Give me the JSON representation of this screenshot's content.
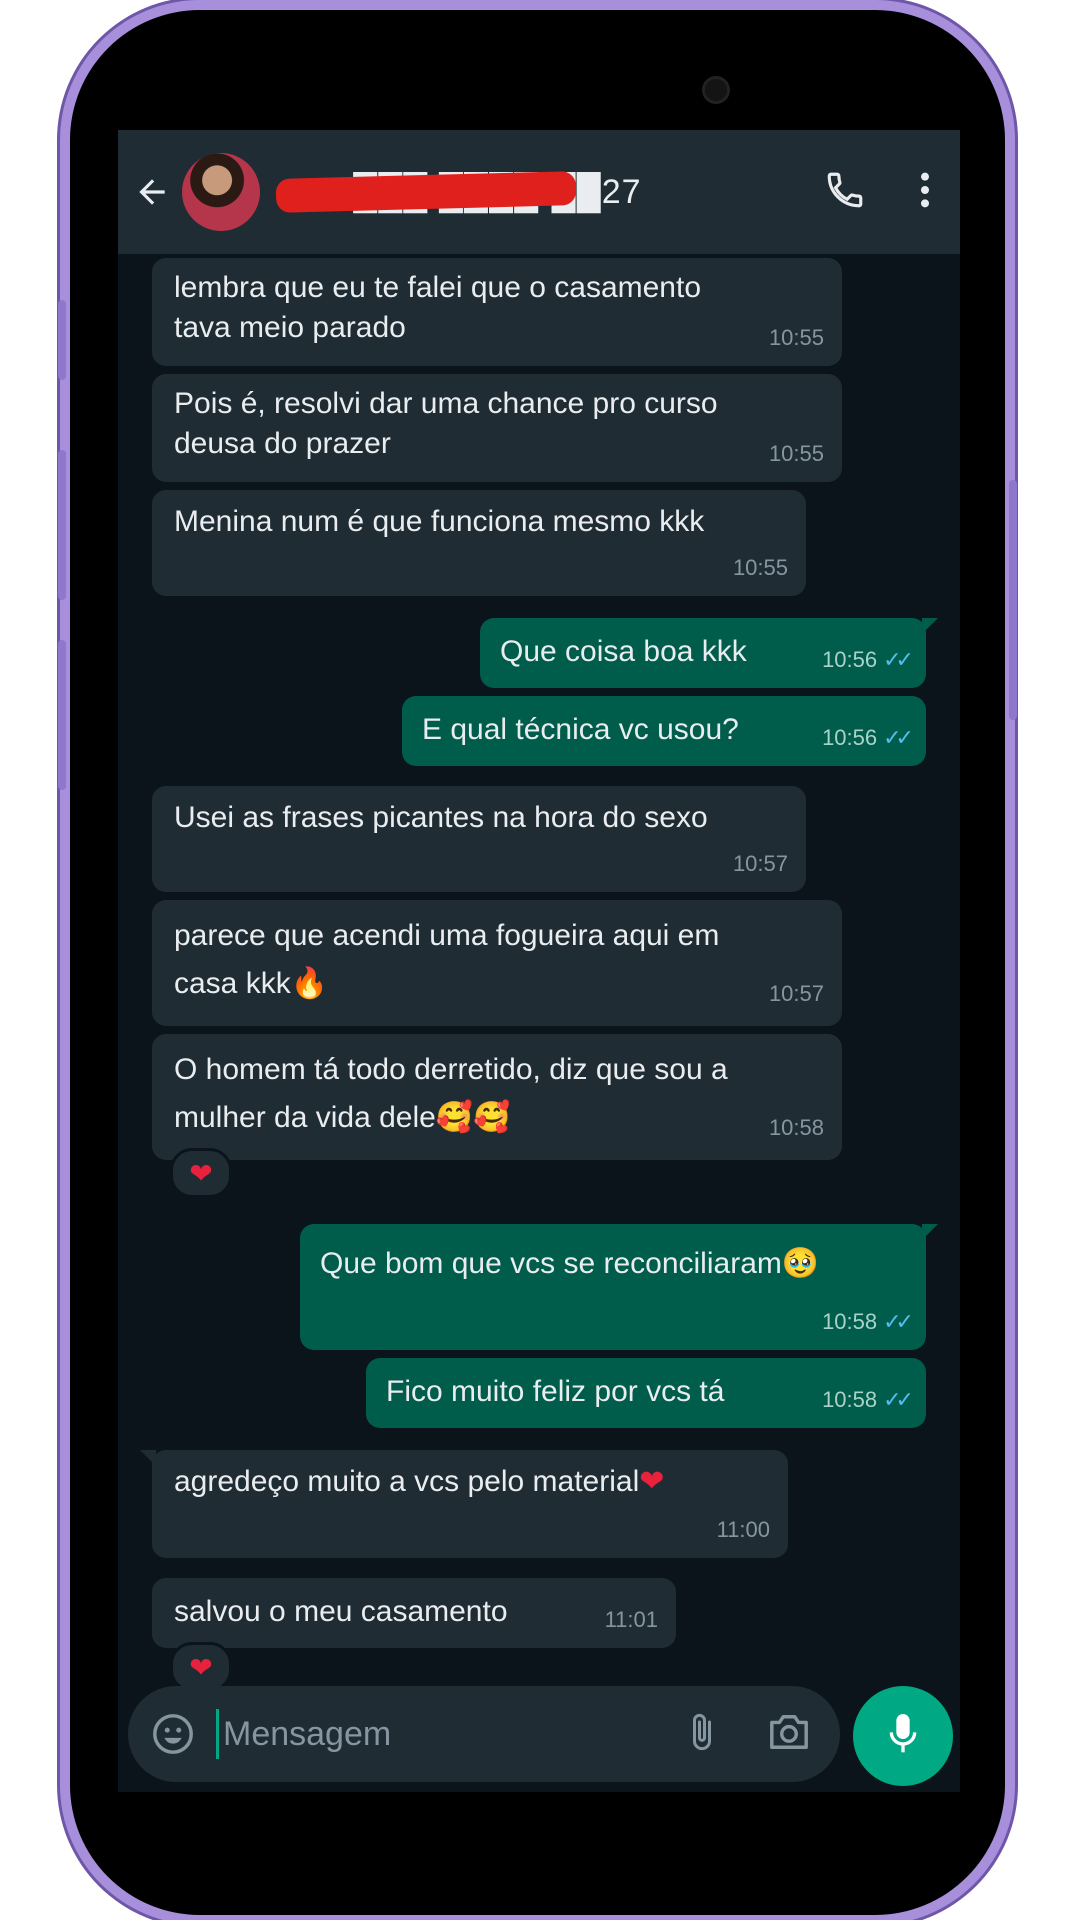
{
  "header": {
    "contact_number": "+55 ███ ████-██27"
  },
  "input": {
    "placeholder": "Mensagem"
  },
  "messages": [
    {
      "text_line1": "lembra que eu te falei que o casamento",
      "text_line2": "tava meio parado",
      "time": "10:55"
    },
    {
      "text_line1": "Pois é, resolvi dar uma chance pro curso",
      "text_line2": "deusa do prazer",
      "time": "10:55"
    },
    {
      "text": "Menina num é que funciona mesmo kkk",
      "time": "10:55"
    },
    {
      "text": "Que coisa boa kkk",
      "time": "10:56"
    },
    {
      "text": "E qual técnica vc usou?",
      "time": "10:56"
    },
    {
      "text": "Usei as frases picantes na hora do sexo",
      "time": "10:57"
    },
    {
      "text_line1": "parece que acendi uma fogueira aqui em",
      "text_line2": "casa kkk",
      "emoji": "🔥",
      "time": "10:57"
    },
    {
      "text_line1": "O homem tá todo derretido, diz que sou a",
      "text_line2": "mulher da vida dele",
      "emoji": "🥰🥰",
      "time": "10:58",
      "reaction": "❤"
    },
    {
      "text": "Que bom que vcs se reconciliaram",
      "emoji": "🥹",
      "time": "10:58"
    },
    {
      "text": "Fico muito feliz por vcs tá",
      "time": "10:58"
    },
    {
      "text": "agredeço muito a vcs pelo material",
      "emoji": "❤",
      "time": "11:00"
    },
    {
      "text": "salvou o meu casamento",
      "time": "11:01",
      "reaction": "❤"
    }
  ],
  "colors": {
    "header_bg": "#1f2c34",
    "chat_bg": "#0b141a",
    "incoming_bubble": "#202c33",
    "outgoing_bubble": "#005c4b",
    "accent": "#00a884",
    "read_ticks": "#53bdeb"
  },
  "icons": [
    "back-arrow-icon",
    "phone-icon",
    "more-vert-icon",
    "emoji-icon",
    "attach-icon",
    "camera-icon",
    "mic-icon",
    "double-check-icon"
  ]
}
